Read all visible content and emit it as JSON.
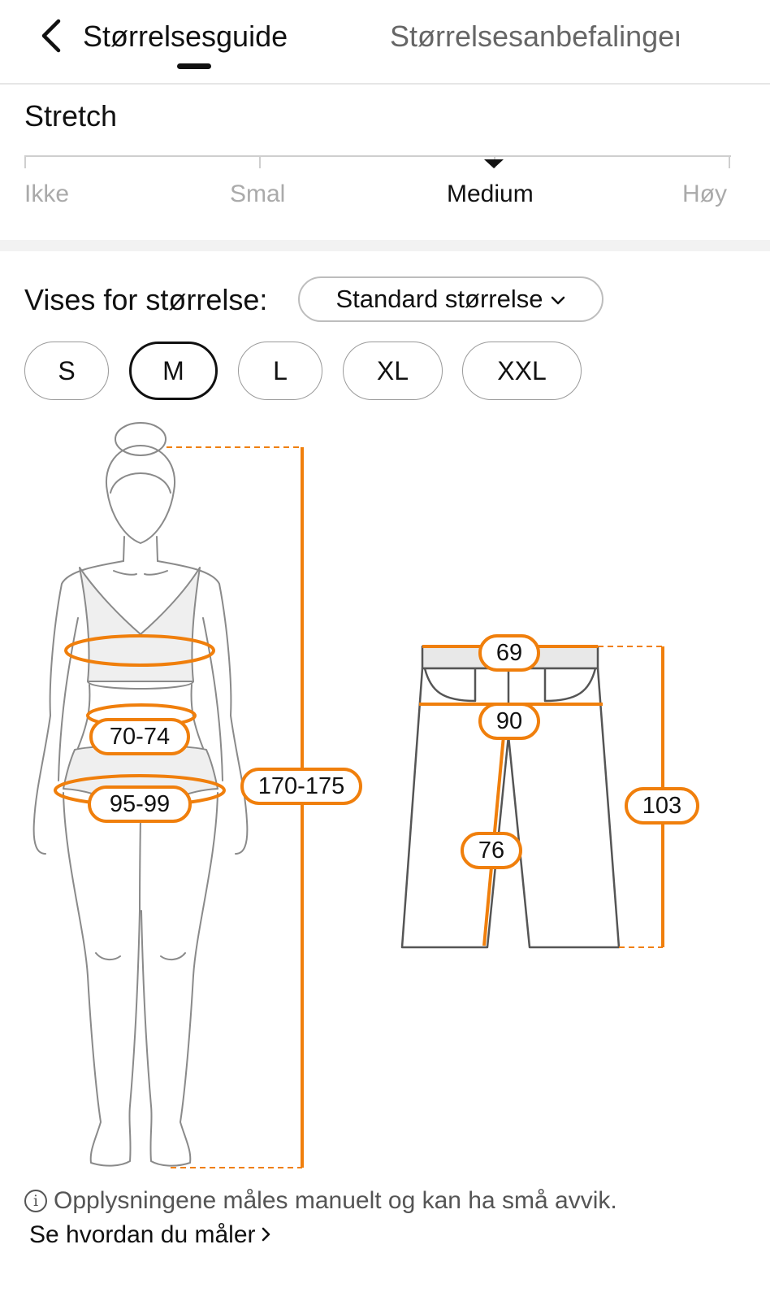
{
  "header": {
    "back_icon": "chevron-left-icon",
    "tabs": [
      {
        "label": "Størrelsesguide",
        "active": true
      },
      {
        "label": "Størrelsesanbefalinger",
        "active": false
      }
    ]
  },
  "stretch": {
    "title": "Stretch",
    "levels": [
      "Ikke",
      "Smal",
      "Medium",
      "Høy"
    ],
    "selected": "Medium"
  },
  "size_selector": {
    "label": "Vises for størrelse:",
    "dropdown_value": "Standard størrelse",
    "dropdown_icon": "chevron-down-icon",
    "sizes": [
      "S",
      "M",
      "L",
      "XL",
      "XXL"
    ],
    "selected": "M"
  },
  "body_measurements": {
    "waist": "70-74",
    "hips": "95-99",
    "height": "170-175"
  },
  "pants_measurements": {
    "waist": "69",
    "hip": "90",
    "inseam": "76",
    "length": "103"
  },
  "accent_color": "#f07f0c",
  "footer": {
    "info_icon": "info-circle-icon",
    "info_text": "Opplysningene måles manuelt og kan ha små avvik.",
    "link_text": "Se hvordan du måler",
    "link_icon": "chevron-right-icon"
  }
}
